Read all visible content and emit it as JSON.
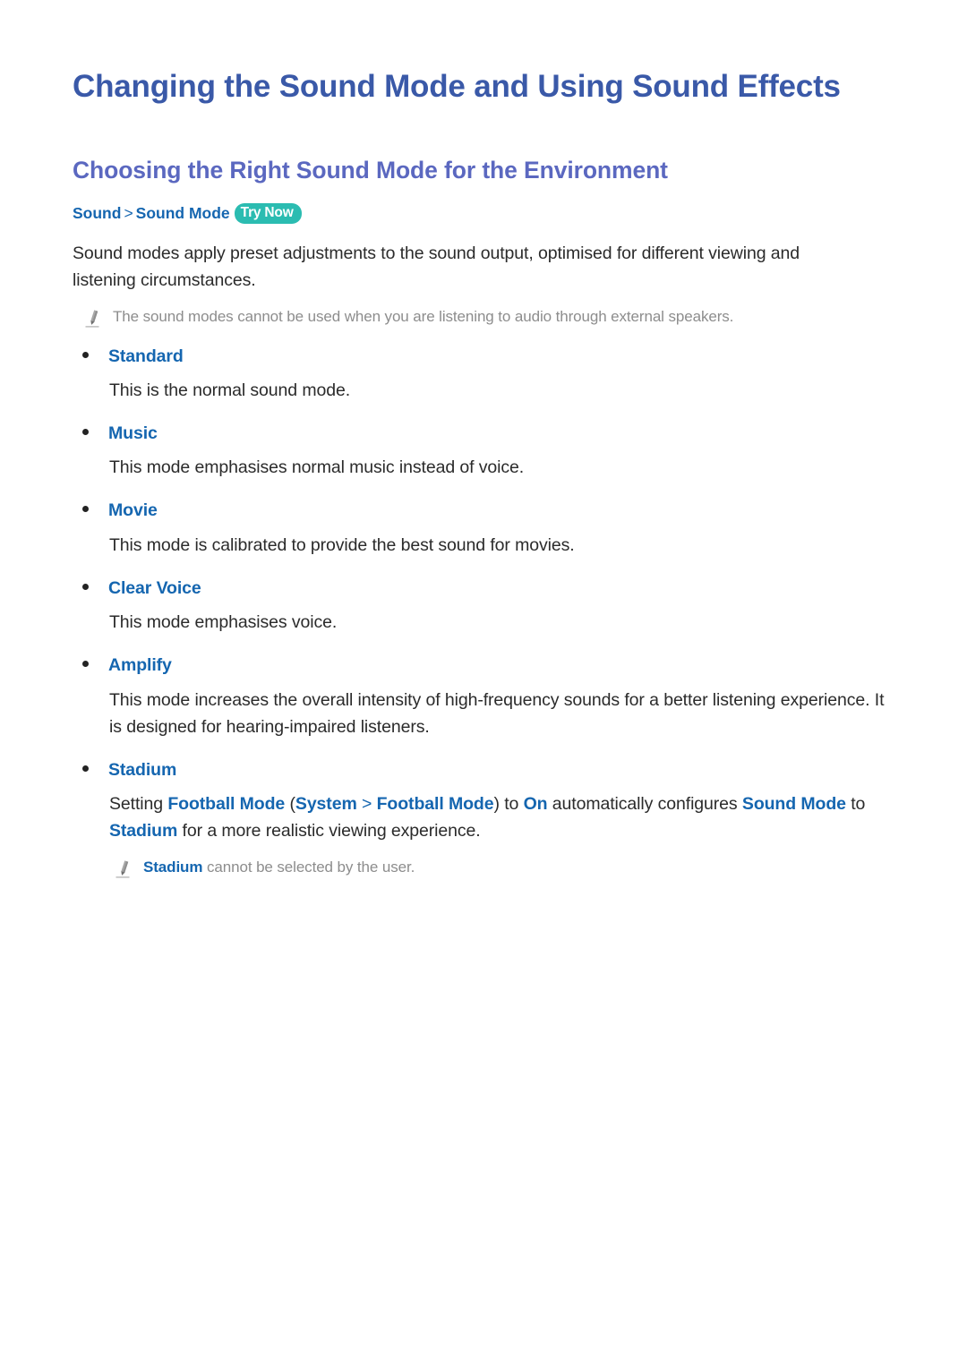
{
  "document": {
    "title": "Changing the Sound Mode and Using Sound Effects",
    "section_heading": "Choosing the Right Sound Mode for the Environment"
  },
  "breadcrumb": {
    "items": [
      "Sound",
      "Sound Mode"
    ],
    "separator": ">",
    "badge": "Try Now"
  },
  "intro": {
    "paragraph": "Sound modes apply preset adjustments to the sound output, optimised for different viewing and listening circumstances.",
    "note": "The sound modes cannot be used when you are listening to audio through external speakers."
  },
  "modes": [
    {
      "name": "Standard",
      "description": "This is the normal sound mode."
    },
    {
      "name": "Music",
      "description": "This mode emphasises normal music instead of voice."
    },
    {
      "name": "Movie",
      "description": "This mode is calibrated to provide the best sound for movies."
    },
    {
      "name": "Clear Voice",
      "description": "This mode emphasises voice."
    },
    {
      "name": "Amplify",
      "description": "This mode increases the overall intensity of high-frequency sounds for a better listening experience. It is designed for hearing-impaired listeners."
    },
    {
      "name": "Stadium",
      "description_parts": {
        "t1": "Setting ",
        "h1": "Football Mode",
        "t2": " (",
        "h2": "System",
        "sep": " > ",
        "h3": "Football Mode",
        "t3": ") to ",
        "h4": "On",
        "t4": " automatically configures ",
        "h5": "Sound Mode",
        "t5": " to ",
        "h6": "Stadium",
        "t6": " for a more realistic viewing experience."
      },
      "note_parts": {
        "h1": "Stadium",
        "t1": " cannot be selected by the user."
      }
    }
  ],
  "colors": {
    "title_blue": "#3a59a8",
    "heading_blue": "#5b68c0",
    "link_blue": "#1566b0",
    "badge_teal": "#2bbcb1",
    "body_text": "#2b2b2b",
    "note_gray": "#8d8d8d"
  }
}
